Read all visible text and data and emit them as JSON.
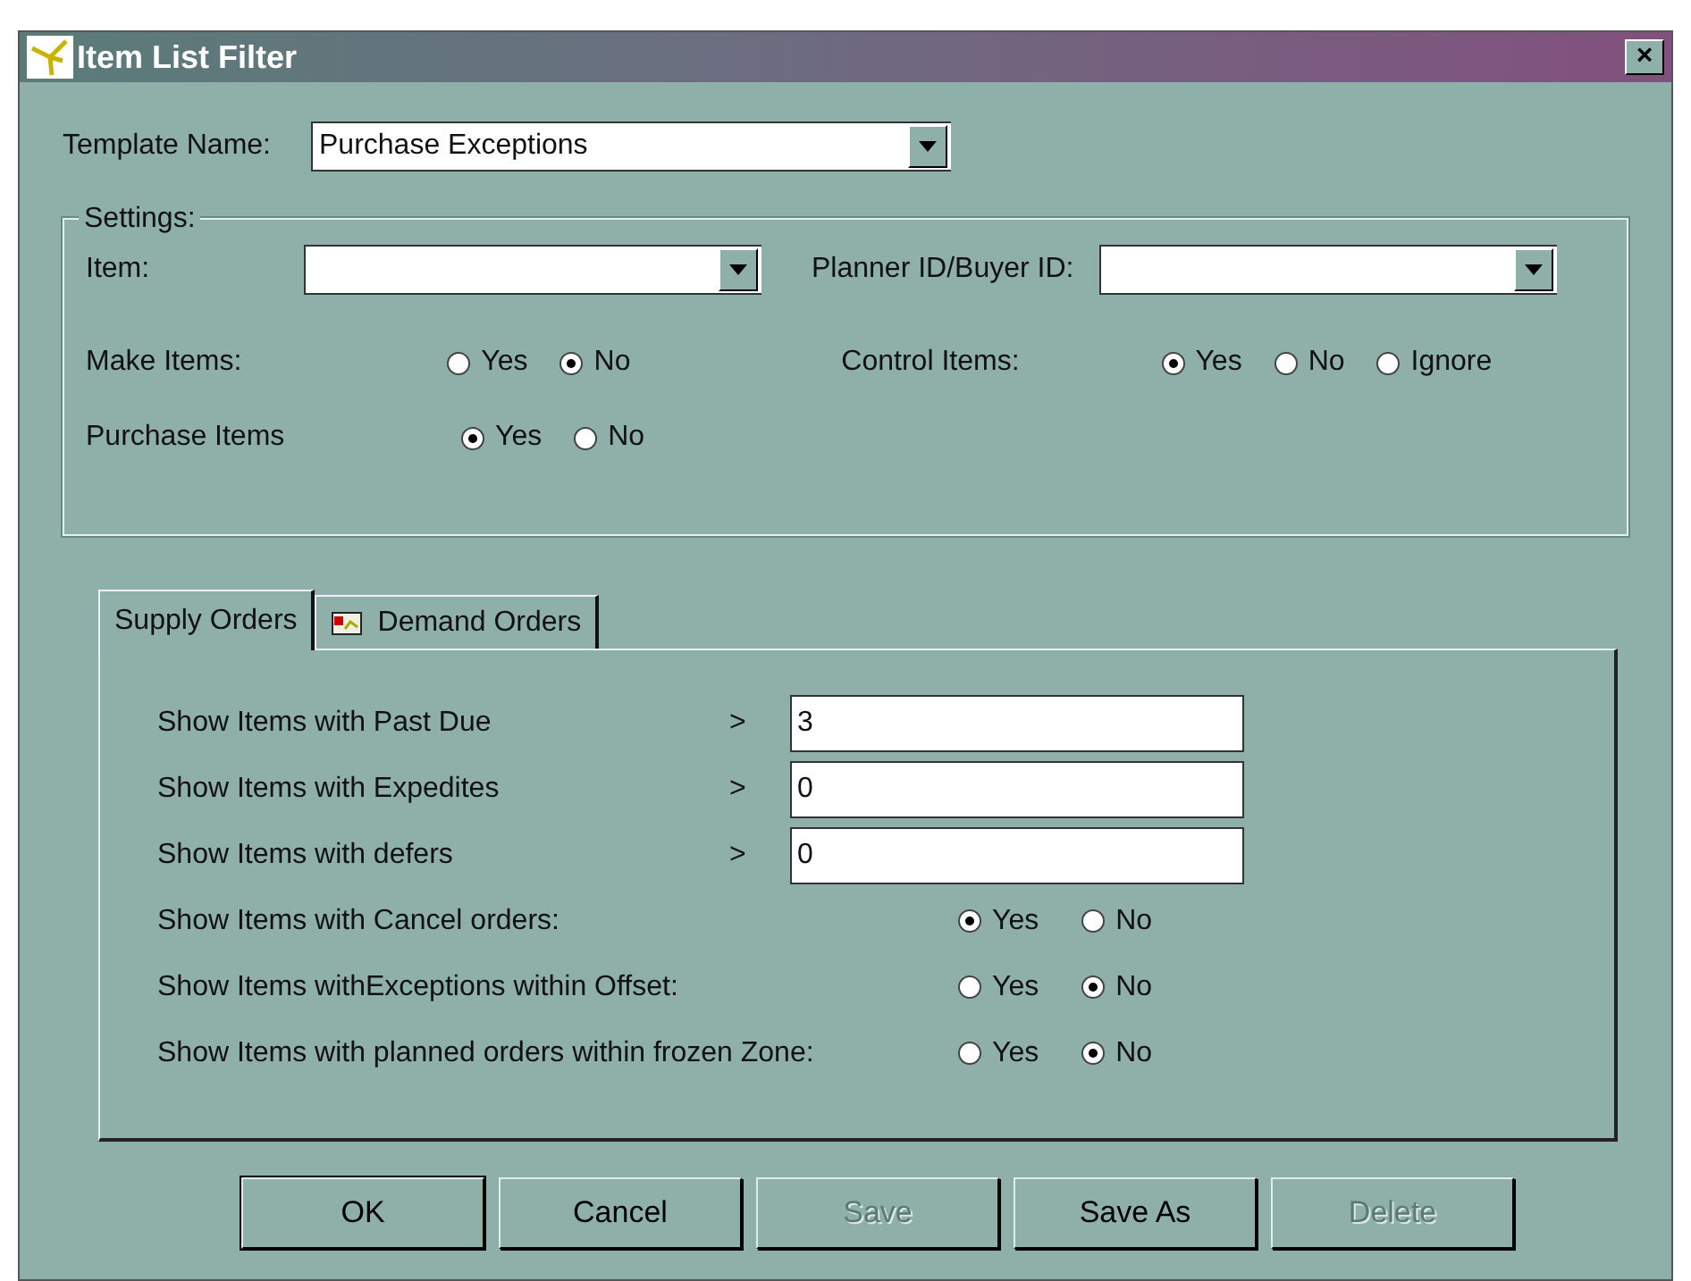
{
  "window": {
    "title": "Item List Filter",
    "close": "×"
  },
  "template": {
    "label": "Template Name:",
    "value": "Purchase Exceptions"
  },
  "settings": {
    "legend": "Settings:",
    "fields": [
      {
        "label": "Item:"
      },
      {
        "label": "Planner ID/Buyer ID:"
      }
    ],
    "radio_groups": [
      {
        "label": "Make Items:",
        "options": [
          {
            "label": "Yes",
            "selected": false
          },
          {
            "label": "No",
            "selected": true
          }
        ]
      },
      {
        "label": "Control Items:",
        "options": [
          {
            "label": "Yes",
            "selected": true
          },
          {
            "label": "No",
            "selected": false
          },
          {
            "label": "Ignore",
            "selected": false
          }
        ]
      },
      {
        "label": "Purchase Items",
        "options": [
          {
            "label": "Yes",
            "selected": true
          },
          {
            "label": "No",
            "selected": false
          }
        ]
      }
    ]
  },
  "tabs": [
    {
      "label": "Supply Orders",
      "selected": true,
      "icon": false
    },
    {
      "label": "Demand Orders",
      "selected": false,
      "icon": true
    }
  ],
  "supply_rows": [
    {
      "kind": "number",
      "label": "Show Items with Past Due",
      "operator": ">",
      "value": "3"
    },
    {
      "kind": "number",
      "label": "Show Items with Expedites",
      "operator": ">",
      "value": "0"
    },
    {
      "kind": "number",
      "label": "Show Items with defers",
      "operator": ">",
      "value": "0"
    },
    {
      "kind": "radio",
      "label": "Show Items with Cancel orders:",
      "options": [
        {
          "label": "Yes",
          "selected": true
        },
        {
          "label": "No",
          "selected": false
        }
      ]
    },
    {
      "kind": "radio",
      "label": "Show Items withExceptions within Offset:",
      "options": [
        {
          "label": "Yes",
          "selected": false
        },
        {
          "label": "No",
          "selected": true
        }
      ]
    },
    {
      "kind": "radio",
      "label": "Show Items with planned orders within frozen Zone:",
      "options": [
        {
          "label": "Yes",
          "selected": false
        },
        {
          "label": "No",
          "selected": true
        }
      ]
    }
  ],
  "buttons": [
    {
      "label": "OK",
      "disabled": false,
      "default": true
    },
    {
      "label": "Cancel",
      "disabled": false,
      "default": false
    },
    {
      "label": "Save",
      "disabled": true,
      "default": false
    },
    {
      "label": "Save As",
      "disabled": false,
      "default": false
    },
    {
      "label": "Delete",
      "disabled": true,
      "default": false
    }
  ]
}
